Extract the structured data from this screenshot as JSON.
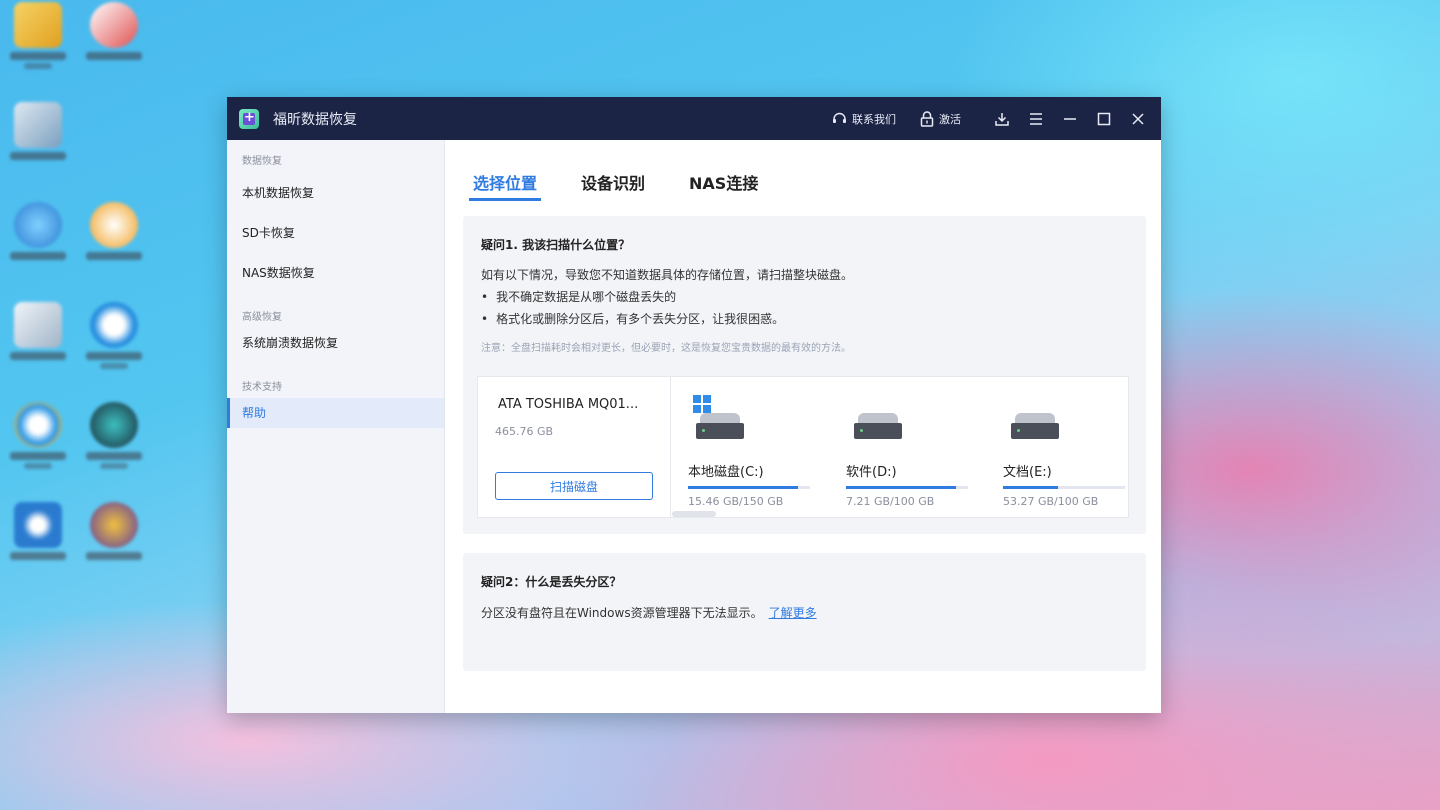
{
  "window": {
    "title": "福昕数据恢复",
    "contact_label": "联系我们",
    "activate_label": "激活"
  },
  "sidebar": {
    "sections": [
      {
        "title": "数据恢复",
        "items": [
          {
            "label": "本机数据恢复"
          },
          {
            "label": "SD卡恢复"
          },
          {
            "label": "NAS数据恢复"
          }
        ]
      },
      {
        "title": "高级恢复",
        "items": [
          {
            "label": "系统崩溃数据恢复"
          }
        ]
      },
      {
        "title": "技术支持",
        "items": [
          {
            "label": "帮助",
            "active": true
          }
        ]
      }
    ]
  },
  "tabs": [
    {
      "label": "选择位置",
      "active": true
    },
    {
      "label": "设备识别"
    },
    {
      "label": "NAS连接"
    }
  ],
  "q1": {
    "title": "疑问1. 我该扫描什么位置？",
    "desc": "如有以下情况，导致您不知道数据具体的存储位置，请扫描整块磁盘。",
    "bullets": [
      "我不确定数据是从哪个磁盘丢失的",
      "格式化或删除分区后，有多个丢失分区，让我很困惑。"
    ],
    "note": "注意：全盘扫描耗时会相对更长，但必要时，这是恢复您宝贵数据的最有效的方法。"
  },
  "disk": {
    "name": "ATA  TOSHIBA MQ01...",
    "size": "465.76 GB",
    "scan_label": "扫描磁盘",
    "partitions": [
      {
        "name": "本地磁盘(C:)",
        "capacity": "15.46 GB/150 GB",
        "used_fraction": 0.9,
        "system": true
      },
      {
        "name": "软件(D:)",
        "capacity": "7.21 GB/100 GB",
        "used_fraction": 0.9,
        "system": false
      },
      {
        "name": "文档(E:)",
        "capacity": "53.27 GB/100 GB",
        "used_fraction": 0.45,
        "system": false
      }
    ]
  },
  "q2": {
    "title": "疑问2：什么是丢失分区？",
    "desc": "分区没有盘符且在Windows资源管理器下无法显示。",
    "link": "了解更多"
  },
  "colors": {
    "accent": "#2f7be0",
    "titlebar": "#1c2446"
  }
}
